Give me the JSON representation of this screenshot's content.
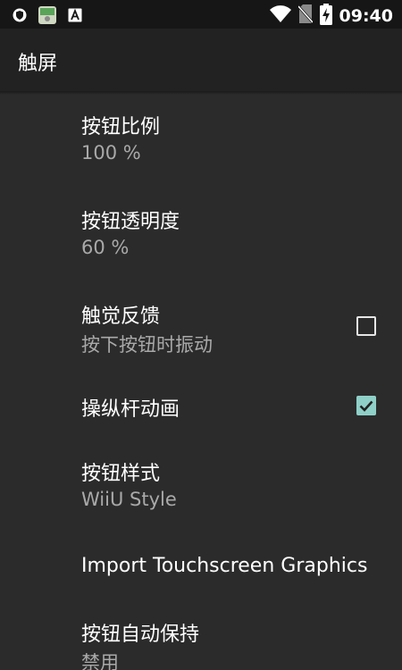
{
  "status_bar": {
    "time": "09:40",
    "icons": [
      "shield-icon",
      "app-icon",
      "font-a-icon",
      "wifi-icon",
      "no-sim-icon",
      "battery-charging-icon"
    ]
  },
  "toolbar": {
    "title": "触屏"
  },
  "prefs": [
    {
      "title": "按钮比例",
      "summary": "100 %"
    },
    {
      "title": "按钮透明度",
      "summary": "60 %"
    },
    {
      "title": "触觉反馈",
      "summary": "按下按钮时振动",
      "checked": false
    },
    {
      "title": "操纵杆动画",
      "checked": true
    },
    {
      "title": "按钮样式",
      "summary": "WiiU Style"
    },
    {
      "title": "Import Touchscreen Graphics"
    },
    {
      "title": "按钮自动保持",
      "summary": "禁用"
    }
  ],
  "colors": {
    "accent": "#8fd0c8",
    "background": "#2b2b2b",
    "toolbar": "#222222",
    "status_bar": "#161616",
    "summary": "#a9a9a9"
  }
}
